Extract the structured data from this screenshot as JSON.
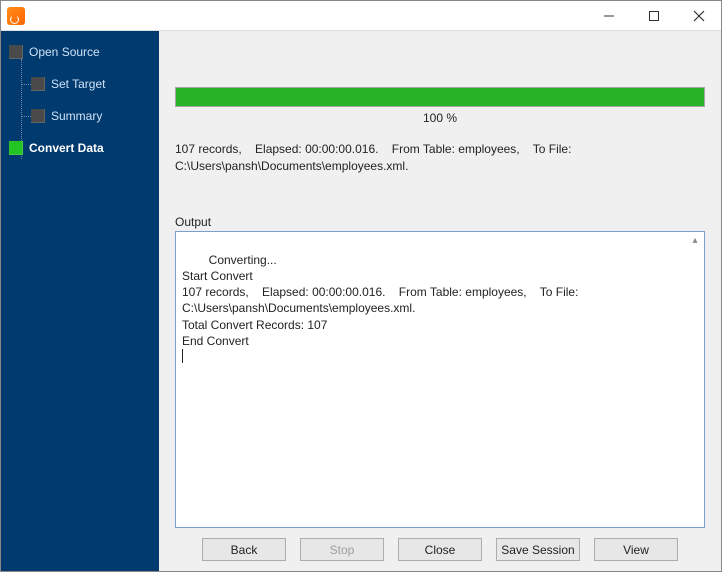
{
  "title": "",
  "sidebar": {
    "items": [
      {
        "label": "Open Source",
        "active": false
      },
      {
        "label": "Set Target",
        "active": false
      },
      {
        "label": "Summary",
        "active": false
      },
      {
        "label": "Convert Data",
        "active": true
      }
    ]
  },
  "progress": {
    "percent_label": "100 %",
    "percent": 100
  },
  "status": "107 records,    Elapsed: 00:00:00.016.    From Table: employees,    To File: C:\\Users\\pansh\\Documents\\employees.xml.",
  "output_label": "Output",
  "output_text": "Converting...\nStart Convert\n107 records,    Elapsed: 00:00:00.016.    From Table: employees,    To File: C:\\Users\\pansh\\Documents\\employees.xml.\nTotal Convert Records: 107\nEnd Convert",
  "buttons": {
    "back": "Back",
    "stop": "Stop",
    "close": "Close",
    "save_session": "Save Session",
    "view": "View"
  }
}
